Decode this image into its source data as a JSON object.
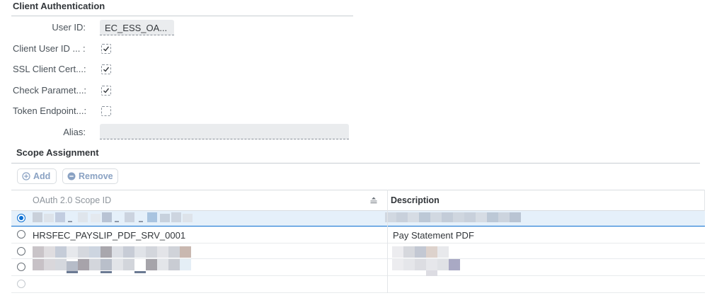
{
  "client_auth": {
    "title": "Client Authentication",
    "user_id_label": "User ID:",
    "user_id_value": "EC_ESS_OA...",
    "client_user_id_label": "Client User ID ... :",
    "client_user_id_checked": true,
    "ssl_cert_label": "SSL Client Cert...:",
    "ssl_cert_checked": true,
    "check_params_label": "Check Paramet...:",
    "check_params_checked": true,
    "token_endpoint_label": "Token Endpoint...:",
    "token_endpoint_checked": false,
    "alias_label": "Alias:",
    "alias_value": ""
  },
  "scope": {
    "title": "Scope Assignment",
    "add_label": "Add",
    "remove_label": "Remove",
    "columns": {
      "scope_id": "OAuth 2.0 Scope ID",
      "description": "Description"
    },
    "rows": [
      {
        "scope_id": "",
        "description": "",
        "selected": true,
        "redacted": true
      },
      {
        "scope_id": "HRSFEC_PAYSLIP_PDF_SRV_0001",
        "description": "Pay Statement PDF",
        "selected": false,
        "redacted": false
      },
      {
        "scope_id": "",
        "description": "",
        "selected": false,
        "redacted": true
      },
      {
        "scope_id": "",
        "description": "",
        "selected": false,
        "redacted": true
      },
      {
        "scope_id": "",
        "description": "",
        "selected": false,
        "redacted": false,
        "empty": true
      }
    ]
  },
  "colors": {
    "accent": "#0a6ed1",
    "disabled_button_text": "#8aa2c3",
    "selected_row_bg": "#e5f0fa"
  }
}
